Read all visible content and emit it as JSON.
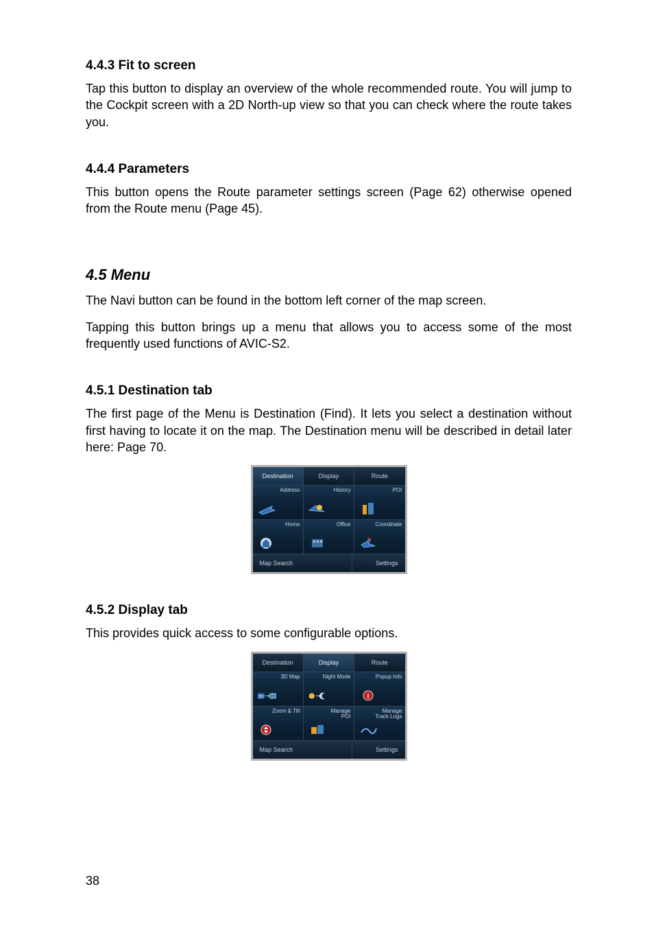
{
  "sections": {
    "fit": {
      "heading": "4.4.3  Fit to screen",
      "body": "Tap this button to display an overview of the whole recommended route. You will jump to the Cockpit screen with a 2D North-up view so that you can check where the route takes you."
    },
    "params": {
      "heading": "4.4.4  Parameters",
      "body": "This button opens the Route parameter settings screen (Page 62) otherwise opened from the Route menu (Page 45)."
    },
    "menu": {
      "heading": "4.5  Menu",
      "p1": "The Navi button can be found in the bottom left corner of the map screen.",
      "p2": "Tapping this button brings up a menu that allows you to access some of the most frequently used functions of AVIC-S2."
    },
    "dest": {
      "heading": "4.5.1  Destination tab",
      "body": "The first page of the Menu is Destination (Find). It lets you select a destination without first having to locate it on the map. The Destination menu will be described in detail later here: Page 70."
    },
    "display": {
      "heading": "4.5.2  Display tab",
      "body": "This provides quick access to some configurable options."
    }
  },
  "device1": {
    "tabs": [
      "Destination",
      "Display",
      "Route"
    ],
    "activeTabIndex": 0,
    "cells": [
      "Address",
      "History",
      "POI",
      "Home",
      "Office",
      "Coordinate"
    ],
    "footer": {
      "left": "Map Search",
      "right": "Settings"
    }
  },
  "device2": {
    "tabs": [
      "Destination",
      "Display",
      "Route"
    ],
    "activeTabIndex": 1,
    "cells": [
      "3D Map",
      "Night Mode",
      "Popup Info",
      "Zoom & Tilt",
      "Manage\nPOI",
      "Manage\nTrack Logs"
    ],
    "footer": {
      "left": "Map Search",
      "right": "Settings"
    }
  },
  "pageNumber": "38"
}
